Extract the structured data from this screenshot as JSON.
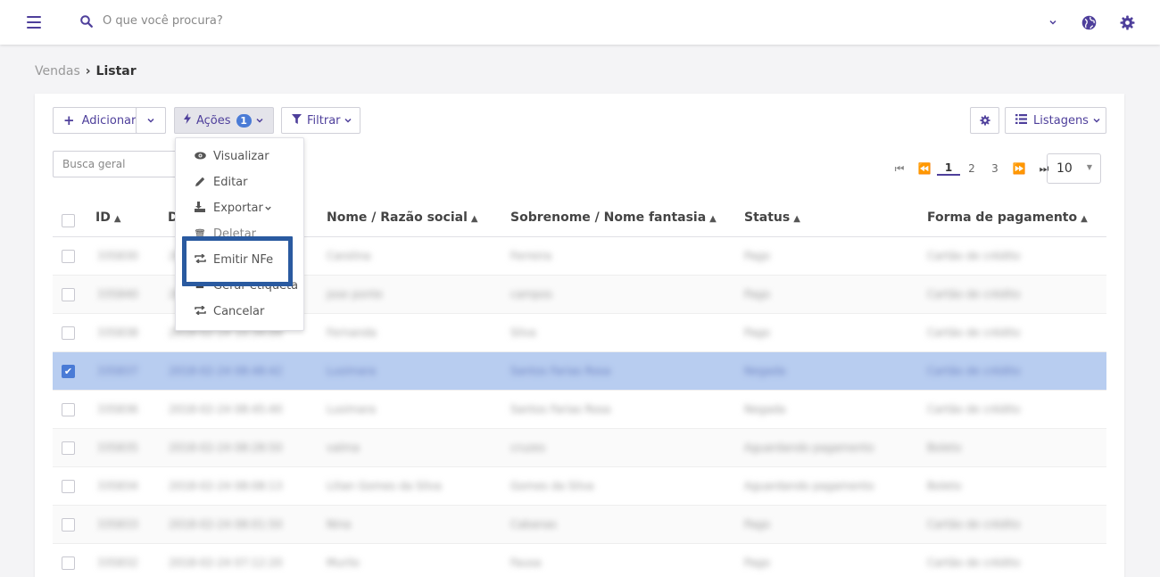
{
  "search": {
    "placeholder": "O que você procura?"
  },
  "icons": {
    "menu": "hamburger-icon",
    "search": "search-icon",
    "globe": "globe-icon",
    "settings": "gear-icon"
  },
  "breadcrumb": {
    "parent": "Vendas",
    "current": "Listar"
  },
  "toolbar": {
    "add_label": "Adicionar",
    "acoes_label": "Ações",
    "acoes_count": "1",
    "filtrar_label": "Filtrar",
    "listagens_label": "Listagens"
  },
  "busca_geral": {
    "placeholder": "Busca geral"
  },
  "pagination": {
    "pages": [
      "1",
      "2",
      "3"
    ],
    "current": "1",
    "page_size": "10"
  },
  "table": {
    "headers": [
      "ID",
      "D",
      "Nome / Razão social",
      "Sobrenome / Nome fantasia",
      "Status",
      "Forma de pagamento"
    ],
    "rows": [
      {
        "id": "335830",
        "date": "2018-02-25 09:12:10",
        "nome": "Carolina",
        "sobrenome": "Ferreira",
        "status": "Pago",
        "pagamento": "Cartão de crédito",
        "selected": false
      },
      {
        "id": "335840",
        "date": "2018-02-24 18:30:12",
        "nome": "jose ponte",
        "sobrenome": "campos",
        "status": "Pago",
        "pagamento": "Cartão de crédito",
        "selected": false
      },
      {
        "id": "335838",
        "date": "2018-02-24 10:34:09",
        "nome": "Fernanda",
        "sobrenome": "Silva",
        "status": "Pago",
        "pagamento": "Cartão de crédito",
        "selected": false
      },
      {
        "id": "335837",
        "date": "2018-02-24 08:48:42",
        "nome": "Lusimara",
        "sobrenome": "Santos Farias Rosa",
        "status": "Negada",
        "pagamento": "Cartão de crédito",
        "selected": true
      },
      {
        "id": "335836",
        "date": "2018-02-24 08:45:40",
        "nome": "Lusimara",
        "sobrenome": "Santos Farias Rosa",
        "status": "Negada",
        "pagamento": "Cartão de crédito",
        "selected": false
      },
      {
        "id": "335835",
        "date": "2018-02-24 08:28:50",
        "nome": "valma",
        "sobrenome": "cruzes",
        "status": "Aguardando pagamento",
        "pagamento": "Boleto",
        "selected": false
      },
      {
        "id": "335834",
        "date": "2018-02-24 08:08:13",
        "nome": "Lilian Gomes da Silva",
        "sobrenome": "Gomes da Silva",
        "status": "Aguardando pagamento",
        "pagamento": "Boleto",
        "selected": false
      },
      {
        "id": "335833",
        "date": "2018-02-24 08:01:50",
        "nome": "Nina",
        "sobrenome": "Cabanas",
        "status": "Pago",
        "pagamento": "Cartão de crédito",
        "selected": false
      },
      {
        "id": "335832",
        "date": "2018-02-24 07:12:20",
        "nome": "Murilo",
        "sobrenome": "Fausa",
        "status": "Pago",
        "pagamento": "Cartão de crédito",
        "selected": false
      }
    ]
  },
  "actions_menu": {
    "items": [
      {
        "label": "Visualizar",
        "icon": "eye-icon"
      },
      {
        "label": "Editar",
        "icon": "pencil-icon"
      },
      {
        "label": "Exportar",
        "icon": "export-icon"
      },
      {
        "label": "Deletar",
        "icon": "trash-icon"
      },
      {
        "label": "Emitir NFe",
        "icon": "exchange-icon"
      },
      {
        "label": "Gerar etiqueta",
        "icon": "label-icon"
      },
      {
        "label": "Cancelar",
        "icon": "exchange-icon"
      }
    ]
  },
  "colors": {
    "accent": "#4e3f9b",
    "badge": "#4a7bd6",
    "selected_row": "#b8cdf0",
    "highlight_box": "#2a5aa0"
  }
}
